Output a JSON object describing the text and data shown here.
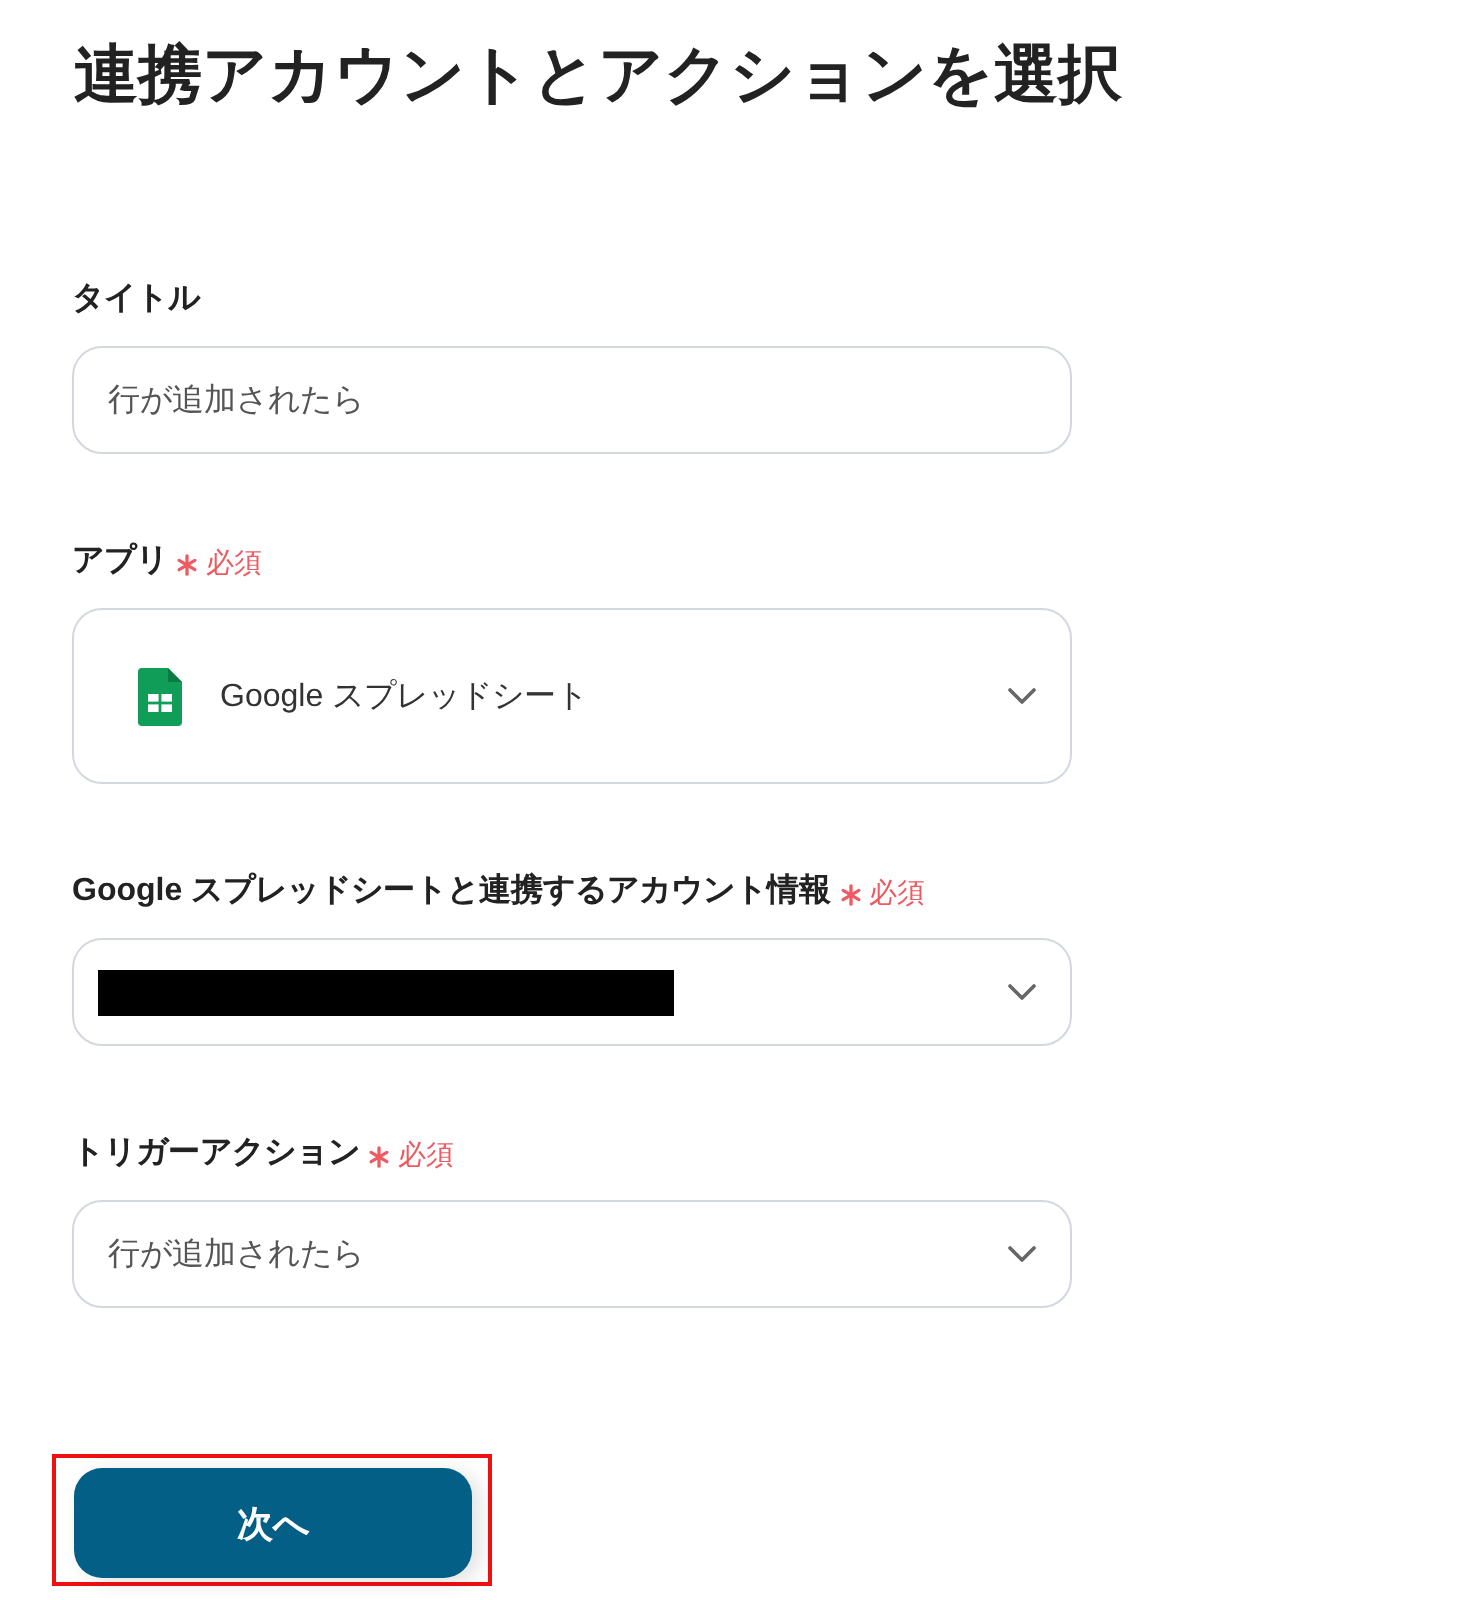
{
  "title": "連携アカウントとアクションを選択",
  "fields": [
    {
      "kind": "text",
      "label": "タイトル",
      "required": false,
      "value": "行が追加されたら"
    },
    {
      "kind": "app-select",
      "label": "アプリ",
      "required": true,
      "required_text": "必須",
      "value": "Google スプレッドシート"
    },
    {
      "kind": "select",
      "label": "Google スプレッドシートと連携するアカウント情報",
      "required": true,
      "required_text": "必須",
      "redacted": true
    },
    {
      "kind": "select",
      "label": "トリガーアクション",
      "required": true,
      "required_text": "必須",
      "value": "行が追加されたら"
    }
  ],
  "button": {
    "label": "次へ",
    "highlighted": true
  }
}
